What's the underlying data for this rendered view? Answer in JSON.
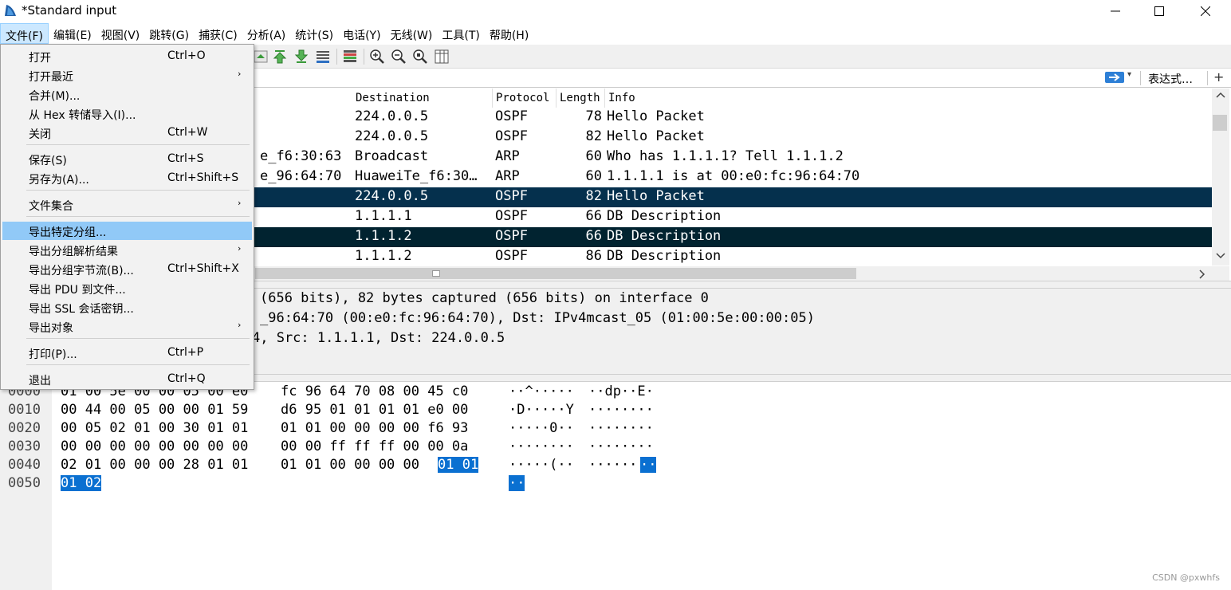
{
  "window": {
    "title": "*Standard input"
  },
  "menubar": [
    "文件(F)",
    "编辑(E)",
    "视图(V)",
    "跳转(G)",
    "捕获(C)",
    "分析(A)",
    "统计(S)",
    "电话(Y)",
    "无线(W)",
    "工具(T)",
    "帮助(H)"
  ],
  "filter": {
    "expression_label": "表达式…",
    "add_label": "+"
  },
  "packet_list": {
    "columns": [
      "Destination",
      "Protocol",
      "Length",
      "Info"
    ],
    "rows": [
      {
        "src": "",
        "dst": "224.0.0.5",
        "proto": "OSPF",
        "len": "78",
        "info": "Hello Packet",
        "style": ""
      },
      {
        "src": "",
        "dst": "224.0.0.5",
        "proto": "OSPF",
        "len": "82",
        "info": "Hello Packet",
        "style": ""
      },
      {
        "src": "e_f6:30:63",
        "dst": "Broadcast",
        "proto": "ARP",
        "len": "60",
        "info": "Who has 1.1.1.1? Tell 1.1.1.2",
        "style": ""
      },
      {
        "src": "e_96:64:70",
        "dst": "HuaweiTe_f6:30…",
        "proto": "ARP",
        "len": "60",
        "info": "1.1.1.1 is at 00:e0:fc:96:64:70",
        "style": ""
      },
      {
        "src": "",
        "dst": "224.0.0.5",
        "proto": "OSPF",
        "len": "82",
        "info": "Hello Packet",
        "style": "sel-a"
      },
      {
        "src": "",
        "dst": "1.1.1.1",
        "proto": "OSPF",
        "len": "66",
        "info": "DB Description",
        "style": ""
      },
      {
        "src": "",
        "dst": "1.1.1.2",
        "proto": "OSPF",
        "len": "66",
        "info": "DB Description",
        "style": "sel-b"
      },
      {
        "src": "",
        "dst": "1.1.1.2",
        "proto": "OSPF",
        "len": "86",
        "info": "DB Description",
        "style": ""
      }
    ]
  },
  "details": [
    "(656 bits), 82 bytes captured (656 bits) on interface 0",
    "_96:64:70 (00:e0:fc:96:64:70), Dst: IPv4mcast_05 (01:00:5e:00:00:05)",
    "4, Src: 1.1.1.1, Dst: 224.0.0.5"
  ],
  "bytes": {
    "offsets": [
      "0000",
      "0010",
      "0020",
      "0030",
      "0040",
      "0050"
    ],
    "hex_a": [
      "01 00 5e 00 00 05 00 e0",
      "00 44 00 05 00 00 01 59",
      "00 05 02 01 00 30 01 01",
      "00 00 00 00 00 00 00 00",
      "02 01 00 00 00 28 01 01",
      ""
    ],
    "hex_b": [
      "fc 96 64 70 08 00 45 c0",
      "d6 95 01 01 01 01 e0 00",
      "01 01 00 00 00 00 f6 93",
      "00 00 ff ff ff 00 00 0a",
      "01 01 00 00 00 00",
      ""
    ],
    "hex_hl": [
      "",
      "",
      "",
      "",
      "01 01",
      "01 02"
    ],
    "ascii_a": [
      "··^·····",
      "·D·····Y",
      "·····0··",
      "········",
      "·····(··",
      ""
    ],
    "ascii_b": [
      "··dp··E·",
      "········",
      "········",
      "········",
      "······",
      ""
    ],
    "ascii_hl": [
      "",
      "",
      "",
      "",
      "··",
      "··"
    ]
  },
  "file_menu": [
    {
      "label": "打开",
      "shortcut": "Ctrl+O",
      "sub": false
    },
    {
      "label": "打开最近",
      "shortcut": "",
      "sub": true
    },
    {
      "label": "合并(M)...",
      "shortcut": "",
      "sub": false
    },
    {
      "label": "从 Hex 转储导入(I)...",
      "shortcut": "",
      "sub": false
    },
    {
      "label": "关闭",
      "shortcut": "Ctrl+W",
      "sub": false
    },
    {
      "label": "保存(S)",
      "shortcut": "Ctrl+S",
      "sub": false
    },
    {
      "label": "另存为(A)...",
      "shortcut": "Ctrl+Shift+S",
      "sub": false
    },
    {
      "label": "文件集合",
      "shortcut": "",
      "sub": true
    },
    {
      "label": "导出特定分组...",
      "shortcut": "",
      "sub": false
    },
    {
      "label": "导出分组解析结果",
      "shortcut": "",
      "sub": true
    },
    {
      "label": "导出分组字节流(B)...",
      "shortcut": "Ctrl+Shift+X",
      "sub": false
    },
    {
      "label": "导出 PDU 到文件...",
      "shortcut": "",
      "sub": false
    },
    {
      "label": "导出 SSL 会话密钥...",
      "shortcut": "",
      "sub": false
    },
    {
      "label": "导出对象",
      "shortcut": "",
      "sub": true
    },
    {
      "label": "打印(P)...",
      "shortcut": "Ctrl+P",
      "sub": false
    },
    {
      "label": "退出",
      "shortcut": "Ctrl+Q",
      "sub": false
    }
  ],
  "submenu_arrow": "›",
  "watermark": "CSDN @pxwhfs",
  "colors": {
    "selected_row_a": "#05304d",
    "selected_row_b": "#012330",
    "menu_hover": "#91c9f7",
    "byte_highlight": "#0a70d1"
  },
  "icons": [
    "wireshark-fin-icon",
    "minimize-icon",
    "maximize-icon",
    "close-icon",
    "go-first-icon",
    "go-last-icon",
    "autoscroll-icon",
    "colorize-icon",
    "zoom-in-icon",
    "zoom-out-icon",
    "zoom-reset-icon",
    "resize-columns-icon",
    "apply-filter-icon"
  ]
}
